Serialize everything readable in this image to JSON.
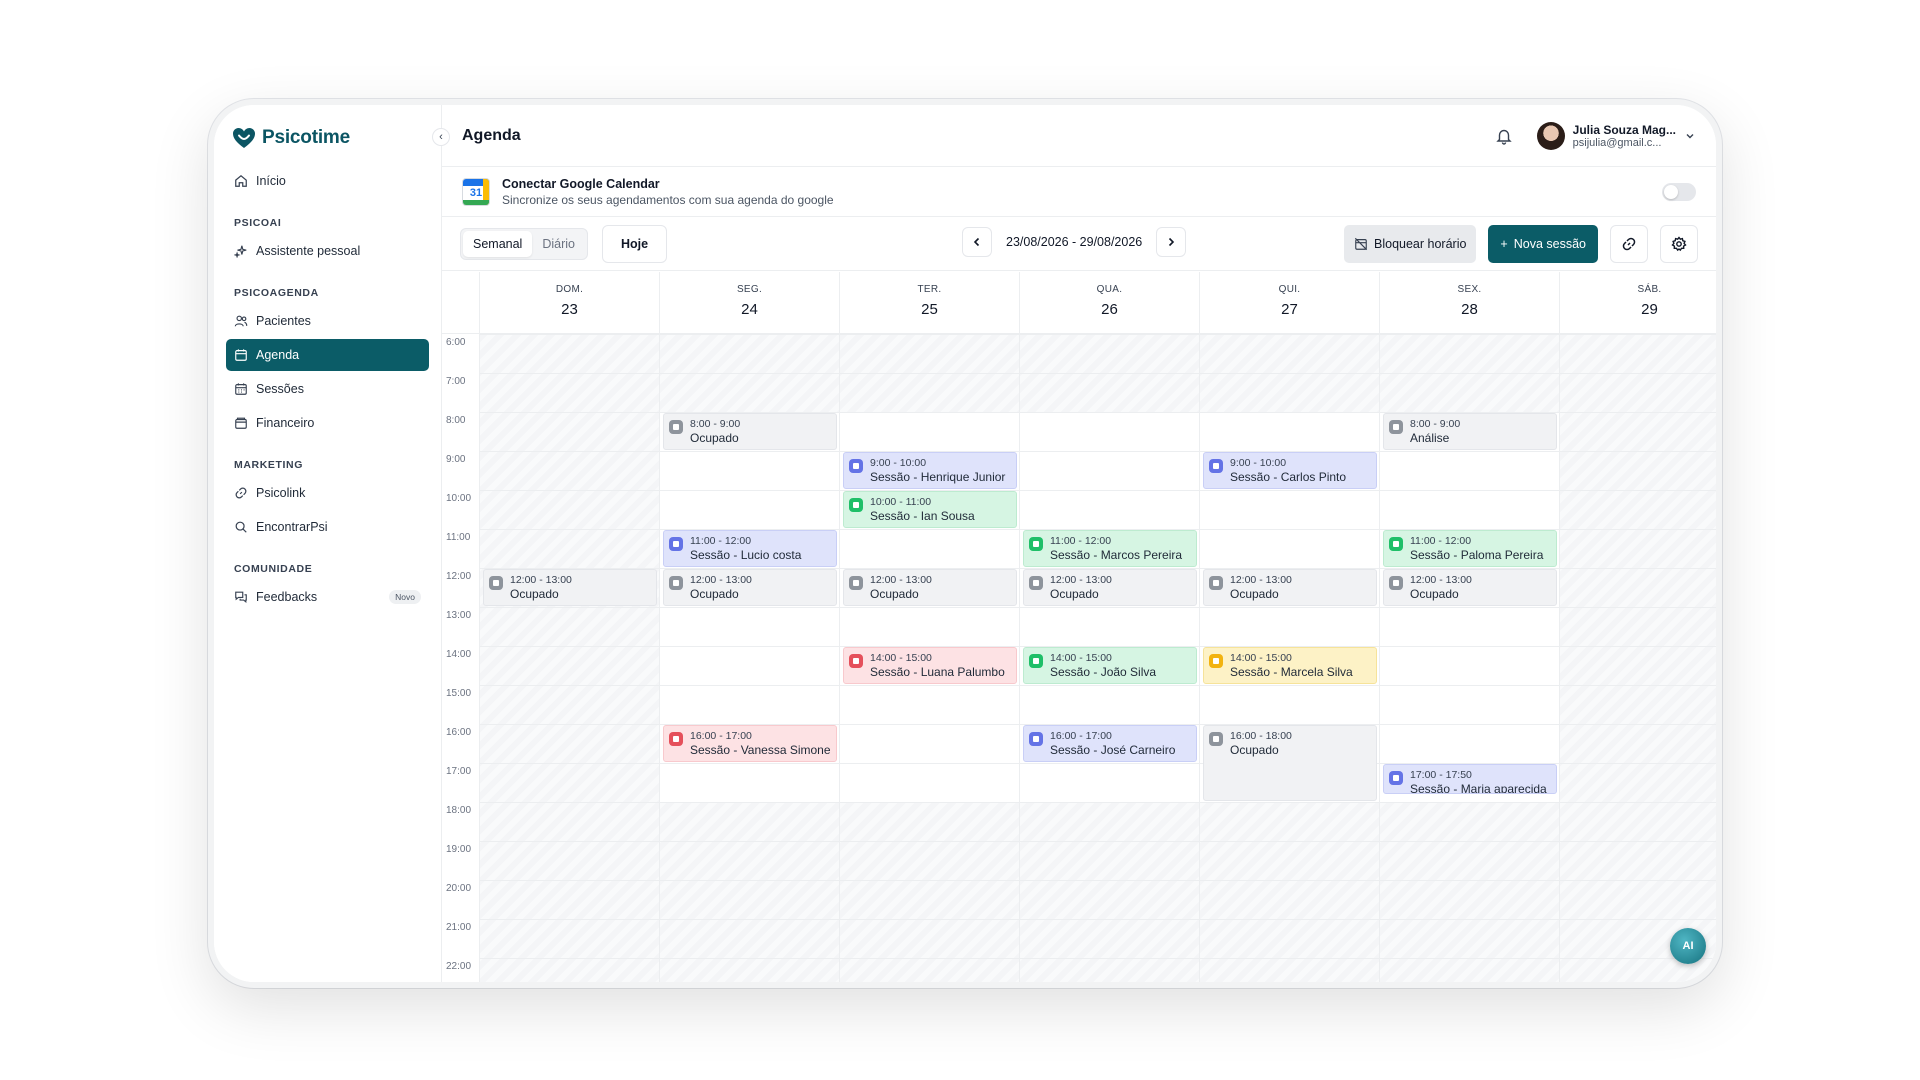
{
  "app": {
    "name": "Psicotime",
    "brand_color": "#0b5c67"
  },
  "sidebar": {
    "items": [
      {
        "key": "inicio",
        "label": "Início",
        "icon": "home-icon"
      }
    ],
    "sections": [
      {
        "title": "PSICOAI",
        "items": [
          {
            "label": "Assistente pessoal",
            "icon": "sparkles-icon"
          }
        ]
      },
      {
        "title": "PSICOAGENDA",
        "items": [
          {
            "label": "Pacientes",
            "icon": "users-icon"
          },
          {
            "label": "Agenda",
            "icon": "calendar-icon",
            "active": true
          },
          {
            "label": "Sessões",
            "icon": "calendar-grid-icon"
          },
          {
            "label": "Financeiro",
            "icon": "wallet-icon"
          }
        ]
      },
      {
        "title": "MARKETING",
        "items": [
          {
            "label": "Psicolink",
            "icon": "link-icon"
          },
          {
            "label": "EncontrarPsi",
            "icon": "search-icon"
          }
        ]
      },
      {
        "title": "COMUNIDADE",
        "items": [
          {
            "label": "Feedbacks",
            "icon": "chat-icon",
            "badge": "Novo"
          }
        ]
      }
    ]
  },
  "header": {
    "title": "Agenda",
    "user": {
      "name": "Julia Souza Mag...",
      "email": "psijulia@gmail.c..."
    }
  },
  "google_calendar": {
    "icon_day": "31",
    "title": "Conectar Google Calendar",
    "subtitle": "Sincronize os seus agendamentos com sua agenda do google",
    "enabled": false
  },
  "toolbar": {
    "views": [
      "Semanal",
      "Diário"
    ],
    "active_view": "Semanal",
    "today_label": "Hoje",
    "date_range": "23/08/2026 - 29/08/2026",
    "block_label": "Bloquear horário",
    "new_session_label": "Nova sessão"
  },
  "calendar": {
    "days": [
      {
        "dow": "DOM.",
        "num": "23"
      },
      {
        "dow": "SEG.",
        "num": "24"
      },
      {
        "dow": "TER.",
        "num": "25"
      },
      {
        "dow": "QUA.",
        "num": "26"
      },
      {
        "dow": "QUI.",
        "num": "27"
      },
      {
        "dow": "SEX.",
        "num": "28"
      },
      {
        "dow": "SÁB.",
        "num": "29"
      }
    ],
    "hours": [
      "6:00",
      "7:00",
      "8:00",
      "9:00",
      "10:00",
      "11:00",
      "12:00",
      "13:00",
      "14:00",
      "15:00",
      "16:00",
      "17:00",
      "18:00",
      "19:00",
      "20:00",
      "21:00",
      "22:00"
    ],
    "available": {
      "start": 8,
      "end": 18,
      "days": [
        1,
        2,
        3,
        4,
        5
      ]
    },
    "events": [
      {
        "day": 1,
        "start": 8,
        "end": 9,
        "time": "8:00 - 9:00",
        "title": "Ocupado",
        "kind": "gray"
      },
      {
        "day": 5,
        "start": 8,
        "end": 9,
        "time": "8:00 - 9:00",
        "title": "Análise",
        "kind": "gray"
      },
      {
        "day": 2,
        "start": 9,
        "end": 10,
        "time": "9:00 - 10:00",
        "title": "Sessão - Henrique Junior",
        "kind": "blue"
      },
      {
        "day": 4,
        "start": 9,
        "end": 10,
        "time": "9:00 - 10:00",
        "title": "Sessão - Carlos Pinto",
        "kind": "blue"
      },
      {
        "day": 2,
        "start": 10,
        "end": 11,
        "time": "10:00 - 11:00",
        "title": "Sessão - Ian Sousa",
        "kind": "green"
      },
      {
        "day": 1,
        "start": 11,
        "end": 12,
        "time": "11:00 - 12:00",
        "title": "Sessão - Lucio costa",
        "kind": "blue"
      },
      {
        "day": 3,
        "start": 11,
        "end": 12,
        "time": "11:00 - 12:00",
        "title": "Sessão - Marcos Pereira",
        "kind": "green"
      },
      {
        "day": 5,
        "start": 11,
        "end": 12,
        "time": "11:00 - 12:00",
        "title": "Sessão - Paloma Pereira",
        "kind": "green"
      },
      {
        "day": 0,
        "start": 12,
        "end": 13,
        "time": "12:00 - 13:00",
        "title": "Ocupado",
        "kind": "gray"
      },
      {
        "day": 1,
        "start": 12,
        "end": 13,
        "time": "12:00 - 13:00",
        "title": "Ocupado",
        "kind": "gray"
      },
      {
        "day": 2,
        "start": 12,
        "end": 13,
        "time": "12:00 - 13:00",
        "title": "Ocupado",
        "kind": "gray"
      },
      {
        "day": 3,
        "start": 12,
        "end": 13,
        "time": "12:00 - 13:00",
        "title": "Ocupado",
        "kind": "gray"
      },
      {
        "day": 4,
        "start": 12,
        "end": 13,
        "time": "12:00 - 13:00",
        "title": "Ocupado",
        "kind": "gray"
      },
      {
        "day": 5,
        "start": 12,
        "end": 13,
        "time": "12:00 - 13:00",
        "title": "Ocupado",
        "kind": "gray"
      },
      {
        "day": 2,
        "start": 14,
        "end": 15,
        "time": "14:00 - 15:00",
        "title": "Sessão - Luana Palumbo",
        "kind": "red"
      },
      {
        "day": 3,
        "start": 14,
        "end": 15,
        "time": "14:00 - 15:00",
        "title": "Sessão - João Silva",
        "kind": "green"
      },
      {
        "day": 4,
        "start": 14,
        "end": 15,
        "time": "14:00 - 15:00",
        "title": "Sessão - Marcela Silva",
        "kind": "yellow"
      },
      {
        "day": 1,
        "start": 16,
        "end": 17,
        "time": "16:00 - 17:00",
        "title": "Sessão - Vanessa Simone",
        "kind": "red"
      },
      {
        "day": 3,
        "start": 16,
        "end": 17,
        "time": "16:00 - 17:00",
        "title": "Sessão - José Carneiro",
        "kind": "blue"
      },
      {
        "day": 4,
        "start": 16,
        "end": 18,
        "time": "16:00 - 18:00",
        "title": "Ocupado",
        "kind": "gray"
      },
      {
        "day": 5,
        "start": 17,
        "end": 17.83,
        "time": "17:00 - 17:50",
        "title": "Sessão - Maria aparecida",
        "kind": "blue"
      }
    ]
  },
  "assistant": {
    "label": "AI"
  }
}
